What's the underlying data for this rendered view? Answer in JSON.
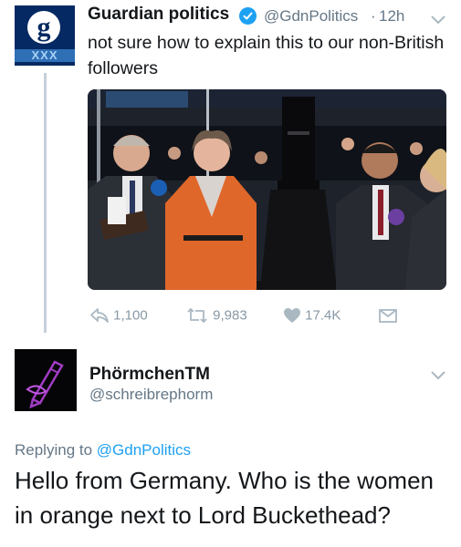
{
  "tweet": {
    "author": {
      "name": "Guardian politics",
      "handle": "@GdnPolitics",
      "verified": true,
      "avatar_icon": "guardian-logo-icon",
      "avatar_letter": "g",
      "avatar_strip": "XXX"
    },
    "separator": "·",
    "time": "12h",
    "text": "not sure how to explain this to our non-British followers",
    "media": {
      "type": "photo"
    },
    "actions": {
      "reply_count": "1,100",
      "retweet_count": "9,983",
      "like_count": "17.4K"
    }
  },
  "reply": {
    "author": {
      "name": "PhörmchenTM",
      "handle": "@schreibrephorm",
      "avatar_icon": "purple-pen-drawing-icon"
    },
    "replying_to_prefix": "Replying to",
    "replying_to_handle": "@GdnPolitics",
    "text": "Hello from Germany. Who is the women in orange next to Lord Buckethead?"
  },
  "colors": {
    "link": "#1da1f2",
    "secondary_text": "#657786",
    "verified_badge": "#1da1f2",
    "guardian_blue": "#052962"
  }
}
